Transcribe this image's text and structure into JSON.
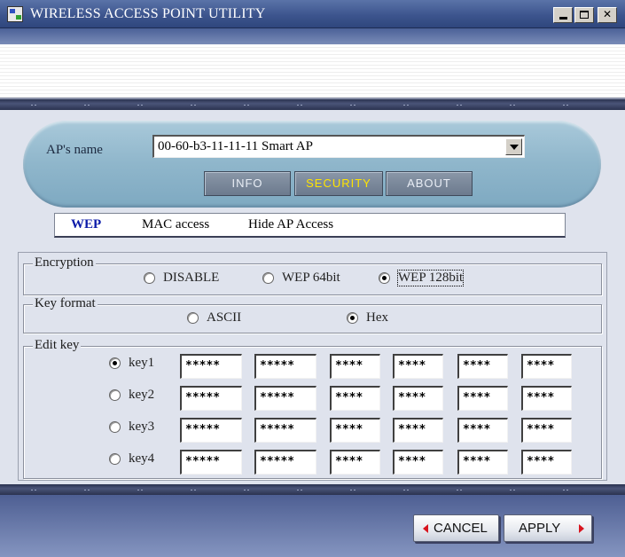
{
  "window": {
    "title": "WIRELESS ACCESS POINT UTILITY",
    "icon": "app-network-icon"
  },
  "ap": {
    "label": "AP's name",
    "selected": "00-60-b3-11-11-11 Smart AP"
  },
  "tabs": {
    "info": "INFO",
    "security": "SECURITY",
    "about": "ABOUT",
    "active": "security",
    "active_color": "#ffe400"
  },
  "subtabs": {
    "wep": "WEP",
    "mac": "MAC access",
    "hide": "Hide AP Access",
    "active": "wep"
  },
  "encryption": {
    "legend": "Encryption",
    "options": [
      "DISABLE",
      "WEP 64bit",
      "WEP 128bit"
    ],
    "selected": "WEP 128bit"
  },
  "key_format": {
    "legend": "Key format",
    "options": [
      "ASCII",
      "Hex"
    ],
    "selected": "Hex"
  },
  "edit_key": {
    "legend": "Edit key",
    "selected": "key1",
    "keys": [
      {
        "label": "key1",
        "fields": [
          "*****",
          "*****",
          "****",
          "****",
          "****",
          "****"
        ]
      },
      {
        "label": "key2",
        "fields": [
          "*****",
          "*****",
          "****",
          "****",
          "****",
          "****"
        ]
      },
      {
        "label": "key3",
        "fields": [
          "*****",
          "*****",
          "****",
          "****",
          "****",
          "****"
        ]
      },
      {
        "label": "key4",
        "fields": [
          "*****",
          "*****",
          "****",
          "****",
          "****",
          "****"
        ]
      }
    ]
  },
  "buttons": {
    "cancel": "CANCEL",
    "apply": "APPLY",
    "arrow_color": "#d8141e"
  }
}
